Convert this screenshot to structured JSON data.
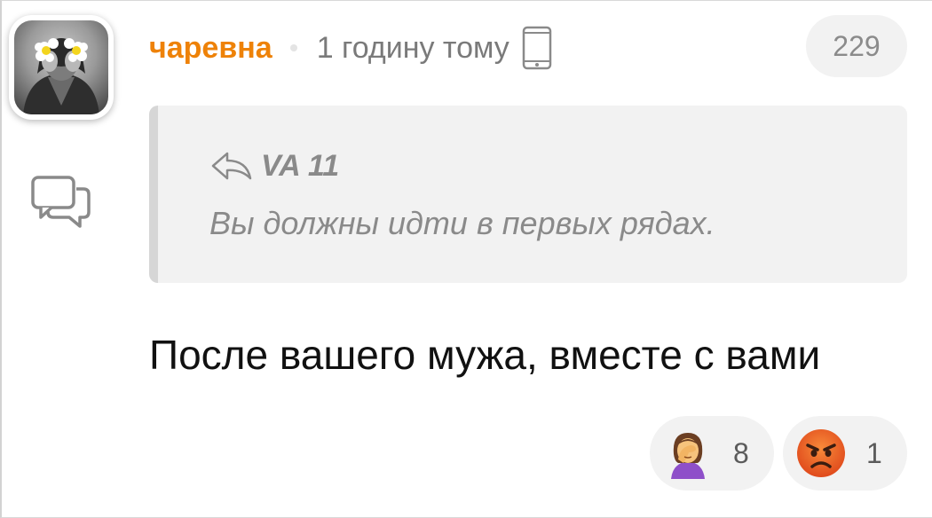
{
  "comment": {
    "author": "чаревна",
    "time": "1 годину тому",
    "likes_count": "229",
    "quote": {
      "author": "VA 11",
      "text": "Вы должны идти в первых рядах."
    },
    "text": "После вашего мужа, вместе с вами",
    "reactions": [
      {
        "emoji": "woman-facepalming-icon",
        "count": "8"
      },
      {
        "emoji": "angry-face-icon",
        "count": "1"
      }
    ]
  },
  "colors": {
    "author": "#ee8208",
    "meta_text": "#7a7a7a",
    "quote_bg": "#f2f2f2",
    "quote_border": "#d6d6d6",
    "pill_bg": "#f2f2f2"
  }
}
